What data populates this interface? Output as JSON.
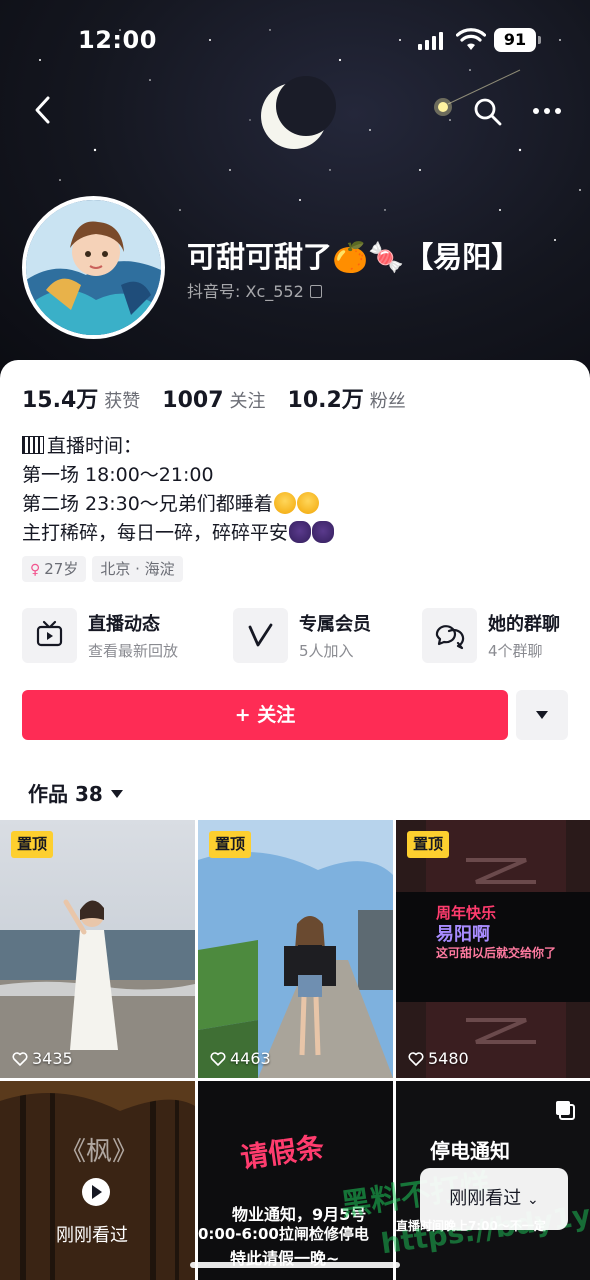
{
  "status_bar": {
    "time": "12:00",
    "battery": "91"
  },
  "profile": {
    "name": "可甜可甜了🍊🍬【易阳】",
    "douyin_id": "抖音号: Xc_552"
  },
  "stats": [
    {
      "value": "15.4万",
      "label": "获赞"
    },
    {
      "value": "1007",
      "label": "关注"
    },
    {
      "value": "10.2万",
      "label": "粉丝"
    }
  ],
  "bio": {
    "line1": "直播时间：",
    "line2": "第一场 18:00～21:00",
    "line3": "第二场 23:30～兄弟们都睡着",
    "line4": "主打稀碎，每日一碎，碎碎平安"
  },
  "tags": {
    "age": "27岁",
    "location": "北京 · 海淀"
  },
  "features": [
    {
      "title": "直播动态",
      "subtitle": "查看最新回放",
      "icon": "tv-icon"
    },
    {
      "title": "专属会员",
      "subtitle": "5人加入",
      "icon": "vip-v-icon"
    },
    {
      "title": "她的群聊",
      "subtitle": "4个群聊",
      "icon": "group-chat-icon"
    }
  ],
  "follow_button": "+ 关注",
  "works_tab": "作品 38",
  "videos": [
    {
      "pinned": "置顶",
      "likes": "3435"
    },
    {
      "pinned": "置顶",
      "likes": "4463"
    },
    {
      "pinned": "置顶",
      "likes": "5480",
      "text1": "周年快乐",
      "text2": "易阳啊",
      "text3": "这可甜以后就交给你了"
    },
    {
      "overlay": "刚刚看过",
      "title": "《枫》"
    },
    {
      "title": "请假条",
      "line1": "物业通知，9月5号",
      "line2": "0:00-6:00拉闸检修停电",
      "line3": "特此请假一晚~"
    },
    {
      "title": "停电通知",
      "line1": "直播时间晚上7:00～不一定"
    }
  ],
  "recently_watched": "刚刚看过",
  "watermark": {
    "line1": "黑料不打烊",
    "line2": "https://bdy1y.cc"
  },
  "colors": {
    "accent": "#fe2c55",
    "pin": "#fdcf2f"
  }
}
